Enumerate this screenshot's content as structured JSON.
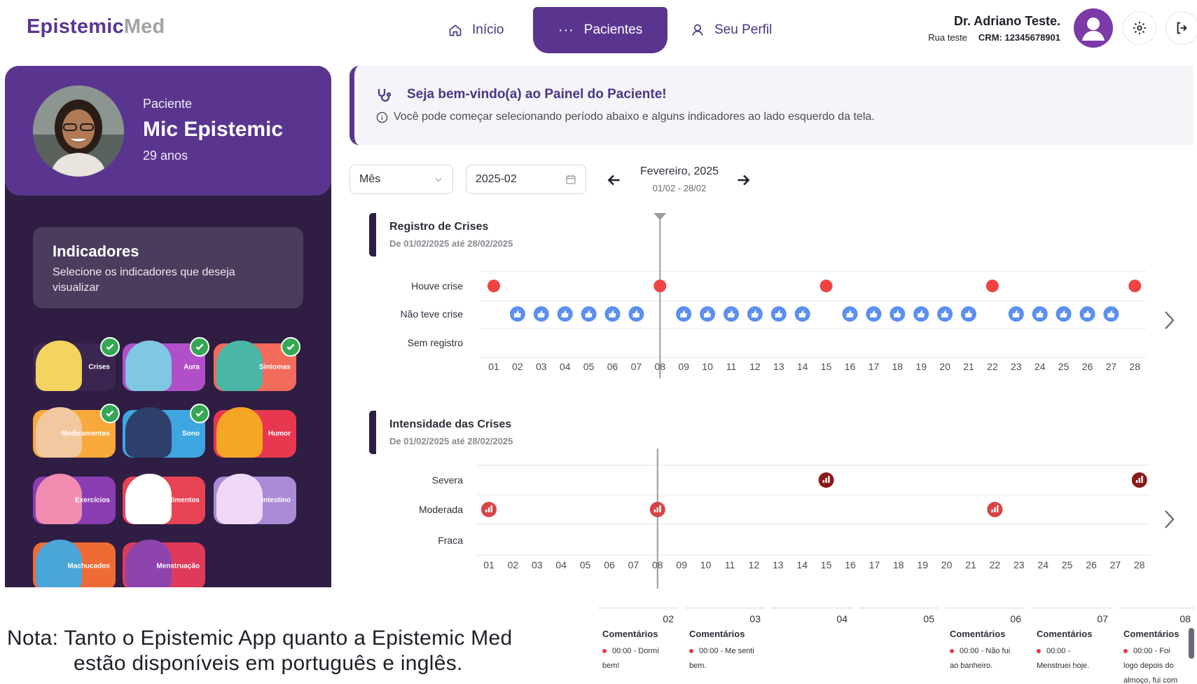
{
  "header": {
    "logo_a": "Epistemic",
    "logo_b": "Med",
    "nav": {
      "home": "Início",
      "patients": "Pacientes",
      "profile": "Seu Perfil"
    },
    "doctor_name": "Dr. Adriano Teste.",
    "doctor_address": "Rua teste",
    "doctor_crm": "CRM: 12345678901"
  },
  "patient": {
    "label": "Paciente",
    "name": "Mic Epistemic",
    "age": "29 anos"
  },
  "indicators": {
    "title": "Indicadores",
    "subtitle": "Selecione os indicadores que deseja visualizar",
    "items": [
      {
        "label": "Crises",
        "color": "#3a2650",
        "art": "#f4d35e",
        "checked": true
      },
      {
        "label": "Aura",
        "color": "#b14fc9",
        "art": "#7ec8e3",
        "checked": true
      },
      {
        "label": "Sintomas",
        "color": "#f26b5b",
        "art": "#49b6a6",
        "checked": true
      },
      {
        "label": "Medicamentos",
        "color": "#f7a93b",
        "art": "#f2c8a0",
        "checked": true
      },
      {
        "label": "Sono",
        "color": "#3ea6e0",
        "art": "#2d3f6a",
        "checked": true
      },
      {
        "label": "Humor",
        "color": "#e8384f",
        "art": "#f5a623",
        "checked": false
      },
      {
        "label": "Exercícios",
        "color": "#8a3db2",
        "art": "#f28cb1",
        "checked": false
      },
      {
        "label": "Alimentos",
        "color": "#e84352",
        "art": "#ffffff",
        "checked": false
      },
      {
        "label": "Intestino",
        "color": "#a98bd6",
        "art": "#f0d9f7",
        "checked": false
      },
      {
        "label": "Machucados",
        "color": "#ef6b36",
        "art": "#4aa6d8",
        "checked": false
      },
      {
        "label": "Menstruação",
        "color": "#e03a5a",
        "art": "#8e44ad",
        "checked": false
      }
    ]
  },
  "welcome": {
    "title": "Seja bem-vindo(a) ao Painel do Paciente!",
    "text": "Você pode começar selecionando período abaixo e alguns indicadores ao lado esquerdo da tela."
  },
  "filters": {
    "period_type": "Mês",
    "date_value": "2025-02",
    "period_title": "Fevereiro, 2025",
    "period_range": "01/02 - 28/02"
  },
  "chart_data": [
    {
      "type": "scatter",
      "title": "Registro de Crises",
      "subtitle": "De 01/02/2025 até 28/02/2025",
      "categories": [
        "Houve crise",
        "Não teve crise",
        "Sem registro"
      ],
      "x": [
        "01",
        "02",
        "03",
        "04",
        "05",
        "06",
        "07",
        "08",
        "09",
        "10",
        "11",
        "12",
        "13",
        "14",
        "15",
        "16",
        "17",
        "18",
        "19",
        "20",
        "21",
        "22",
        "23",
        "24",
        "25",
        "26",
        "27",
        "28"
      ],
      "series": [
        {
          "name": "Houve crise",
          "days": [
            1,
            8,
            15,
            22,
            28
          ],
          "color": "#ef4444"
        },
        {
          "name": "Não teve crise",
          "days": [
            2,
            3,
            4,
            5,
            6,
            7,
            9,
            10,
            11,
            12,
            13,
            14,
            16,
            17,
            18,
            19,
            20,
            21,
            23,
            24,
            25,
            26,
            27
          ],
          "color": "#5b8ff0"
        },
        {
          "name": "Sem registro",
          "days": []
        }
      ],
      "marker_day": 8
    },
    {
      "type": "scatter",
      "title": "Intensidade das Crises",
      "subtitle": "De 01/02/2025 até 28/02/2025",
      "categories": [
        "Severa",
        "Moderada",
        "Fraca"
      ],
      "x": [
        "01",
        "02",
        "03",
        "04",
        "05",
        "06",
        "07",
        "08",
        "09",
        "10",
        "11",
        "12",
        "13",
        "14",
        "15",
        "16",
        "17",
        "18",
        "19",
        "20",
        "21",
        "22",
        "23",
        "24",
        "25",
        "26",
        "27",
        "28"
      ],
      "series": [
        {
          "name": "Severa",
          "days": [
            15,
            28
          ],
          "color": "#8b1a1a"
        },
        {
          "name": "Moderada",
          "days": [
            1,
            8,
            22
          ],
          "color": "#d64545"
        },
        {
          "name": "Fraca",
          "days": []
        }
      ],
      "marker_day": 8
    }
  ],
  "note": {
    "label": "Nota:",
    "line1": "Tanto o Epistemic App quanto a Epistemic Med",
    "line2": "estão disponíveis em português e inglês."
  },
  "comments": [
    {
      "day": "02",
      "title": "Comentários",
      "lines": [
        "00:00 - Dormi",
        "bem!"
      ]
    },
    {
      "day": "03",
      "title": "Comentários",
      "lines": [
        "00:00 - Me senti",
        "bem."
      ]
    },
    {
      "day": "04",
      "title": "",
      "lines": []
    },
    {
      "day": "05",
      "title": "",
      "lines": []
    },
    {
      "day": "06",
      "title": "Comentários",
      "lines": [
        "00:00 - Não fui",
        "ao banheiro."
      ]
    },
    {
      "day": "07",
      "title": "Comentários",
      "lines": [
        "00:00 -",
        "Menstruei hoje."
      ]
    },
    {
      "day": "08",
      "title": "Comentários",
      "lines": [
        "00:00 - Foi",
        "logo depois do",
        "almoço, fui com"
      ]
    }
  ]
}
